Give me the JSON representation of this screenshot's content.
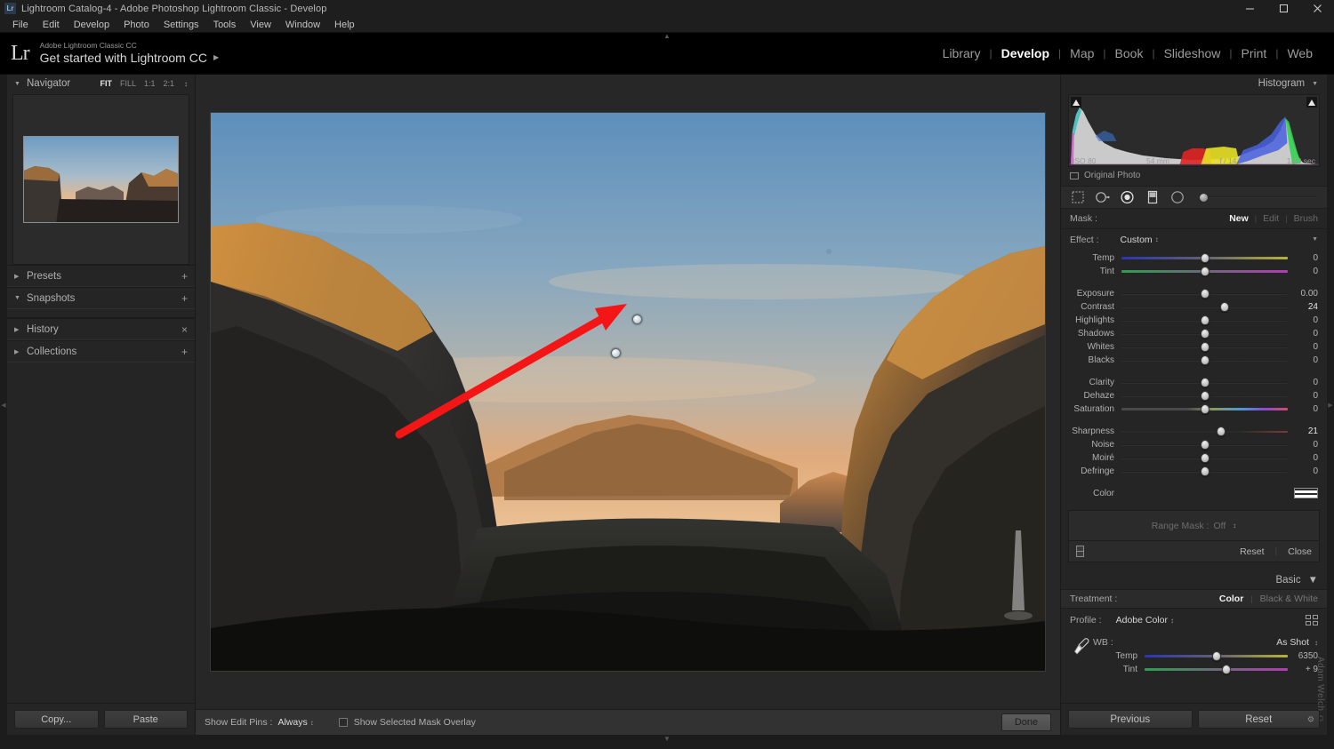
{
  "titlebar": {
    "logo": "Lr",
    "title": "Lightroom Catalog-4 - Adobe Photoshop Lightroom Classic - Develop",
    "minimize": "minimize-icon",
    "maximize": "maximize-icon",
    "close": "close-icon"
  },
  "menubar": {
    "items": [
      "File",
      "Edit",
      "Develop",
      "Photo",
      "Settings",
      "Tools",
      "View",
      "Window",
      "Help"
    ]
  },
  "identity": {
    "logo": "Lr",
    "line1": "Adobe Lightroom Classic CC",
    "line2": "Get started with Lightroom CC",
    "arrow": "▶"
  },
  "modules": {
    "items": [
      {
        "label": "Library",
        "active": false
      },
      {
        "label": "Develop",
        "active": true
      },
      {
        "label": "Map",
        "active": false
      },
      {
        "label": "Book",
        "active": false
      },
      {
        "label": "Slideshow",
        "active": false
      },
      {
        "label": "Print",
        "active": false
      },
      {
        "label": "Web",
        "active": false
      }
    ]
  },
  "left_panel": {
    "navigator": {
      "title": "Navigator",
      "triangle": "▼",
      "zoom_levels": [
        {
          "label": "FIT",
          "active": true
        },
        {
          "label": "FILL",
          "active": false
        },
        {
          "label": "1:1",
          "active": false
        },
        {
          "label": "2:1",
          "active": false
        }
      ],
      "stepper": "↕"
    },
    "sections": [
      {
        "label": "Presets",
        "triangle": "▶",
        "action": "+"
      },
      {
        "label": "Snapshots",
        "triangle": "▼",
        "action": "+"
      },
      {
        "label": "History",
        "triangle": "▶",
        "action": "×"
      },
      {
        "label": "Collections",
        "triangle": "▶",
        "action": "+"
      }
    ],
    "copy_label": "Copy...",
    "paste_label": "Paste"
  },
  "toolbar": {
    "show_edit_pins_label": "Show Edit Pins :",
    "show_edit_pins_value": "Always",
    "stepper": "↕",
    "mask_overlay_label": "Show Selected Mask Overlay",
    "mask_overlay_checked": false,
    "done_label": "Done"
  },
  "right_panel": {
    "histogram": {
      "title": "Histogram",
      "triangle": "▼",
      "iso": "ISO 80",
      "focal": "54 mm",
      "aperture": "f / 14",
      "shutter": "1/10 sec",
      "original_photo": "Original Photo"
    },
    "tools": [
      {
        "name": "crop-overlay-tool",
        "active": false
      },
      {
        "name": "spot-removal-tool",
        "active": false
      },
      {
        "name": "radial-filter-tool",
        "active": true
      },
      {
        "name": "graduated-filter-tool",
        "active": false
      },
      {
        "name": "adjustment-brush-tool",
        "active": false
      }
    ],
    "mask": {
      "label": "Mask :",
      "options": [
        {
          "label": "New",
          "active": true
        },
        {
          "label": "Edit",
          "active": false
        },
        {
          "label": "Brush",
          "active": false
        }
      ]
    },
    "effect": {
      "label": "Effect :",
      "value": "Custom",
      "stepper": "↕",
      "triangle": "▼"
    },
    "sliders": [
      {
        "label": "Temp",
        "value": "0",
        "pos": 50,
        "track": "temp"
      },
      {
        "label": "Tint",
        "value": "0",
        "pos": 50,
        "track": "tint"
      },
      {
        "gap": true
      },
      {
        "label": "Exposure",
        "value": "0.00",
        "pos": 50,
        "track": "plain"
      },
      {
        "label": "Contrast",
        "value": "24",
        "pos": 62,
        "track": "plain",
        "highlight": true
      },
      {
        "label": "Highlights",
        "value": "0",
        "pos": 50,
        "track": "plain"
      },
      {
        "label": "Shadows",
        "value": "0",
        "pos": 50,
        "track": "plain"
      },
      {
        "label": "Whites",
        "value": "0",
        "pos": 50,
        "track": "plain"
      },
      {
        "label": "Blacks",
        "value": "0",
        "pos": 50,
        "track": "plain"
      },
      {
        "gap": true
      },
      {
        "label": "Clarity",
        "value": "0",
        "pos": 50,
        "track": "plain"
      },
      {
        "label": "Dehaze",
        "value": "0",
        "pos": 50,
        "track": "plain"
      },
      {
        "label": "Saturation",
        "value": "0",
        "pos": 50,
        "track": "sat"
      },
      {
        "gap": true
      },
      {
        "label": "Sharpness",
        "value": "21",
        "pos": 60,
        "track": "sharp",
        "highlight": true
      },
      {
        "label": "Noise",
        "value": "0",
        "pos": 50,
        "track": "plain"
      },
      {
        "label": "Moiré",
        "value": "0",
        "pos": 50,
        "track": "plain"
      },
      {
        "label": "Defringe",
        "value": "0",
        "pos": 50,
        "track": "plain"
      }
    ],
    "color": {
      "label": "Color",
      "swatch": "color-swatch"
    },
    "range_mask": {
      "label": "Range Mask :",
      "value": "Off",
      "stepper": "↕",
      "reset_label": "Reset",
      "close_label": "Close",
      "switch_icon": "switch-icon"
    },
    "basic": {
      "title": "Basic",
      "triangle": "▼",
      "treatment_label": "Treatment :",
      "treatments": [
        {
          "label": "Color",
          "active": true
        },
        {
          "label": "Black & White",
          "active": false
        }
      ],
      "profile_label": "Profile :",
      "profile_value": "Adobe Color",
      "profile_stepper": "↕",
      "grid_button": "profile-browser-icon",
      "wb_label": "WB :",
      "wb_value": "As Shot",
      "wb_stepper": "↕",
      "eyedropper": "white-balance-selector-icon",
      "temp_label": "Temp",
      "temp_value": "6350",
      "tint_label": "Tint",
      "tint_value": "+ 9"
    },
    "watermark": "Adam Welch ©",
    "previous_label": "Previous",
    "reset_label": "Reset"
  },
  "canvas": {
    "photo_alt": "yosemite-valley-tunnel-view-sunset",
    "annotation_arrow": "red-arrow-annotation",
    "pins": [
      {
        "name": "radial-filter-pin-upper"
      },
      {
        "name": "radial-filter-pin-selected"
      }
    ]
  },
  "colors": {
    "panel_bg": "#252525",
    "canvas_bg": "#272727",
    "accent_text": "#ffffff",
    "annotation_red": "#f41616"
  }
}
